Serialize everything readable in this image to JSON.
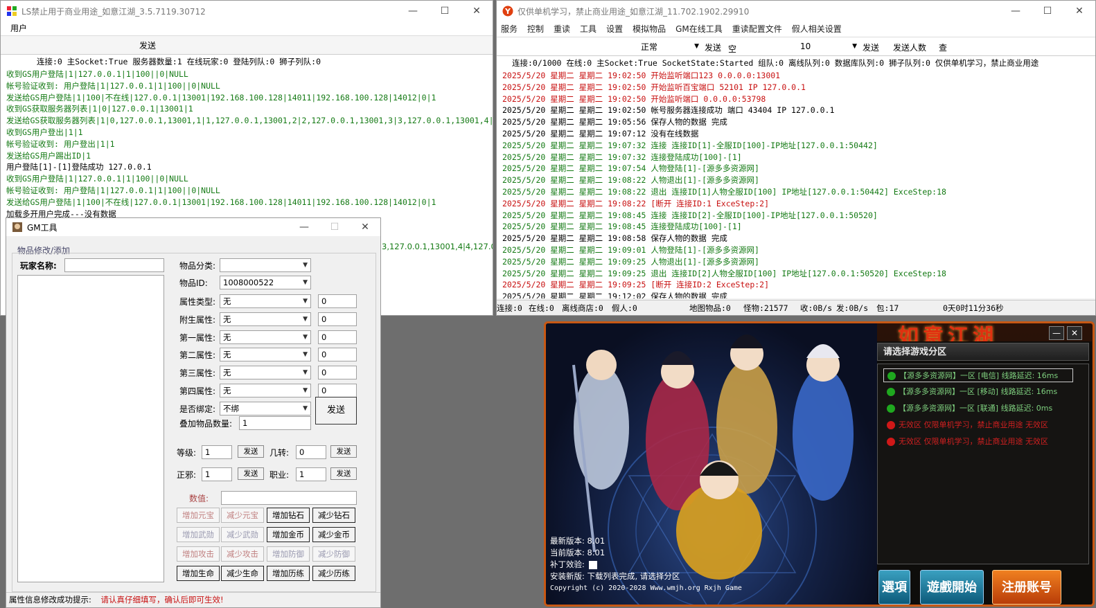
{
  "left_window": {
    "title": "LS禁止用于商业用途_如意江湖_3.5.7119.30712",
    "menu_user": "用户",
    "send_label": "发送",
    "status": "连接:0   主Socket:True   服务器数量:1   在线玩家:0   登陆列队:0   狮子列队:0",
    "log": [
      {
        "text": "收到GS用户登陆|1|127.0.0.1|1|100||0|NULL",
        "color": "green"
      },
      {
        "text": "帐号验证收到: 用户登陆|1|127.0.0.1|1|100||0|NULL",
        "color": "green"
      },
      {
        "text": "发送给GS用户登陆|1|100|不在线|127.0.0.1|13001|192.168.100.128|14011|192.168.100.128|14012|0|1",
        "color": "green"
      },
      {
        "text": "收到GS获取服务器列表|1|0|127.0.0.1|13001|1",
        "color": "green"
      },
      {
        "text": "发送给GS获取服务器列表|1|0,127.0.0.1,13001,1|1,127.0.0.1,13001,2|2,127.0.0.1,13001,3|3,127.0.0.1,13001,4|4,127.0",
        "color": "green"
      },
      {
        "text": "收到GS用户登出|1|1",
        "color": "green"
      },
      {
        "text": "帐号验证收到: 用户登出|1|1",
        "color": "green"
      },
      {
        "text": "发送给GS用户踢出ID|1",
        "color": "green"
      },
      {
        "text": "用户登陆[1]-[1]登陆成功  127.0.0.1",
        "color": "black"
      },
      {
        "text": "收到GS用户登陆|1|127.0.0.1|1|100||0|NULL",
        "color": "green"
      },
      {
        "text": "帐号验证收到: 用户登陆|1|127.0.0.1|1|100||0|NULL",
        "color": "green"
      },
      {
        "text": "发送给GS用户登陆|1|100|不在线|127.0.0.1|13001|192.168.100.128|14011|192.168.100.128|14012|0|1",
        "color": "green"
      },
      {
        "text": "加载多开用户完成---没有数据",
        "color": "black"
      }
    ],
    "log_overflow": "3,127.0.0.1,13001,4|4,127.0"
  },
  "gm_tool": {
    "title": "GM工具",
    "group_label": "物品修改/添加",
    "player_name_label": "玩家名称:",
    "player_name_value": "",
    "item_category_label": "物品分类:",
    "item_category_value": "",
    "item_id_label": "物品ID:",
    "item_id_value": "1008000522",
    "attr_rows": [
      {
        "label": "属性类型:",
        "select": "无",
        "value": "0"
      },
      {
        "label": "附生属性:",
        "select": "无",
        "value": "0"
      },
      {
        "label": "第一属性:",
        "select": "无",
        "value": "0"
      },
      {
        "label": "第二属性:",
        "select": "无",
        "value": "0"
      },
      {
        "label": "第三属性:",
        "select": "无",
        "value": "0"
      },
      {
        "label": "第四属性:",
        "select": "无",
        "value": "0"
      }
    ],
    "bind_label": "是否绑定:",
    "bind_value": "不绑",
    "stack_label": "叠加物品数量:",
    "stack_value": "1",
    "send_big": "发送",
    "level_label": "等级:",
    "level_value": "1",
    "rebirth_label": "几转:",
    "rebirth_value": "0",
    "align_label": "正邪:",
    "align_value": "1",
    "job_label": "职业:",
    "job_value": "1",
    "send_small": "发送",
    "amount_label": "数值:",
    "amount_value": "",
    "buttons": [
      [
        "增加元宝",
        "减少元宝",
        "增加钻石",
        "减少钻石"
      ],
      [
        "增加武勋",
        "减少武勋",
        "增加金币",
        "减少金币"
      ],
      [
        "增加攻击",
        "减少攻击",
        "增加防御",
        "减少防御"
      ],
      [
        "增加生命",
        "减少生命",
        "增加历练",
        "减少历练"
      ]
    ],
    "footer_label": "属性信息修改成功提示:",
    "footer_warning": "请认真仔细填写，确认后即可生效!"
  },
  "right_window": {
    "title": "仅供单机学习，禁止商业用途_如意江湖_11.702.1902.29910",
    "menu": [
      "服务",
      "控制",
      "重读",
      "工具",
      "设置",
      "模拟物品",
      "GM在线工具",
      "重读配置文件",
      "假人相关设置"
    ],
    "mode_value": "正常",
    "send_label": "发送",
    "send_value": "空",
    "count_value": "10",
    "send_label2": "发送",
    "send_count_label": "发送人数",
    "query_label": "查",
    "status": "连接:0/1000   在线:0   主Socket:True   SocketState:Started   组队:0   离线队列:0   数据库队列:0   狮子队列:0   仅供单机学习，禁止商业用途",
    "log": [
      {
        "text": "2025/5/20 星期二 星期二 19:02:50 开始监听端口123 0.0.0.0:13001",
        "color": "red"
      },
      {
        "text": "2025/5/20 星期二 星期二 19:02:50 开始监听百宝端口  52101 IP 127.0.0.1",
        "color": "red"
      },
      {
        "text": "2025/5/20 星期二 星期二 19:02:50 开始监听端口 0.0.0.0:53798",
        "color": "red"
      },
      {
        "text": "2025/5/20 星期二 星期二 19:02:50 帐号服务器连接成功    端口    43404   IP    127.0.0.1",
        "color": "black"
      },
      {
        "text": "2025/5/20 星期二 星期二 19:05:56 保存人物的数据  完成",
        "color": "black"
      },
      {
        "text": "2025/5/20 星期二 星期二 19:07:12 没有在线数据",
        "color": "black"
      },
      {
        "text": "2025/5/20 星期二 星期二 19:07:32 连接  连接ID[1]-全服ID[100]-IP地址[127.0.0.1:50442]",
        "color": "green"
      },
      {
        "text": "2025/5/20 星期二 星期二 19:07:32 连接登陆成功[100]-[1]",
        "color": "green"
      },
      {
        "text": "2025/5/20 星期二 星期二 19:07:54 人物登陆[1]-[源多多资源网]",
        "color": "green"
      },
      {
        "text": "2025/5/20 星期二 星期二 19:08:22 人物退出[1]-[源多多资源网]",
        "color": "green"
      },
      {
        "text": "2025/5/20 星期二 星期二 19:08:22 退出  连接ID[1]人物全服ID[100] IP地址[127.0.0.1:50442] ExceStep:18",
        "color": "green"
      },
      {
        "text": "2025/5/20 星期二 星期二 19:08:22 [断开  连接ID:1 ExceStep:2]",
        "color": "red"
      },
      {
        "text": "2025/5/20 星期二 星期二 19:08:45 连接  连接ID[2]-全服ID[100]-IP地址[127.0.0.1:50520]",
        "color": "green"
      },
      {
        "text": "2025/5/20 星期二 星期二 19:08:45 连接登陆成功[100]-[1]",
        "color": "green"
      },
      {
        "text": "2025/5/20 星期二 星期二 19:08:58 保存人物的数据  完成",
        "color": "black"
      },
      {
        "text": "2025/5/20 星期二 星期二 19:09:01 人物登陆[1]-[源多多资源网]",
        "color": "green"
      },
      {
        "text": "2025/5/20 星期二 星期二 19:09:25 人物退出[1]-[源多多资源网]",
        "color": "green"
      },
      {
        "text": "2025/5/20 星期二 星期二 19:09:25 退出  连接ID[2]人物全服ID[100] IP地址[127.0.0.1:50520] ExceStep:18",
        "color": "green"
      },
      {
        "text": "2025/5/20 星期二 星期二 19:09:25 [断开  连接ID:2 ExceStep:2]",
        "color": "red"
      },
      {
        "text": "2025/5/20 星期二 星期二 19:12:02 保存人物的数据  完成",
        "color": "black"
      }
    ],
    "bottom_status": [
      "连接:0",
      "在线:0",
      "离线商店:0",
      "假人:0",
      "地图物品:0",
      "怪物:21577",
      "收:0B/s",
      "发:0B/s",
      "包:17",
      "0天0时11分36秒"
    ]
  },
  "launcher": {
    "logo_text": "如意江湖",
    "zone_header": "请选择游戏分区",
    "zones": [
      {
        "text": "【源多多资源网】一区 [电信] 线路延迟: 16ms",
        "status": "online"
      },
      {
        "text": "【源多多资源网】一区 [移动] 线路延迟: 16ms",
        "status": "online"
      },
      {
        "text": "【源多多资源网】一区 [联通] 线路延迟: 0ms",
        "status": "online"
      },
      {
        "text": "无效区 仅限单机学习，禁止商业用途 无效区",
        "status": "offline"
      },
      {
        "text": "无效区 仅限单机学习，禁止商业用途 无效区",
        "status": "offline"
      }
    ],
    "latest_version": "最新版本: 8.01",
    "current_version": "当前版本: 8.01",
    "patch_check_label": "补丁效验:",
    "install_status": "安装新版: 下载列表完成, 请选择分区",
    "copyright": "Copyright (c) 2020-2028 Www.wmjh.org Rxjh Game",
    "btn_options": "選項",
    "btn_start": "遊戲開始",
    "btn_register": "注册账号"
  },
  "colors": {
    "log_green": "#147a14",
    "log_red": "#c81010",
    "launcher_frame": "#c85814",
    "zone_online": "#1fa81f",
    "zone_offline": "#d01818"
  }
}
